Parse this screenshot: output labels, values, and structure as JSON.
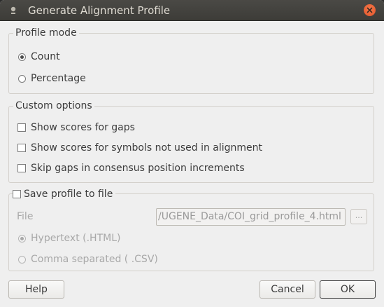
{
  "window": {
    "title": "Generate Alignment Profile"
  },
  "profile_mode": {
    "title": "Profile mode",
    "options": [
      {
        "label": "Count",
        "checked": true
      },
      {
        "label": "Percentage",
        "checked": false
      }
    ]
  },
  "custom_options": {
    "title": "Custom options",
    "items": [
      {
        "label": "Show scores for gaps",
        "checked": false
      },
      {
        "label": "Show scores for symbols not used in alignment",
        "checked": false
      },
      {
        "label": "Skip gaps in consensus position increments",
        "checked": false
      }
    ]
  },
  "save_profile": {
    "title": "Save profile to file",
    "checked": false,
    "file_label": "File",
    "file_value": "/UGENE_Data/COI_grid_profile_4.html",
    "browse_label": "...",
    "formats": [
      {
        "label": "Hypertext  (.HTML)",
        "checked": true
      },
      {
        "label": "Comma separated ( .CSV)",
        "checked": false
      }
    ]
  },
  "buttons": {
    "help": "Help",
    "cancel": "Cancel",
    "ok": "OK"
  }
}
